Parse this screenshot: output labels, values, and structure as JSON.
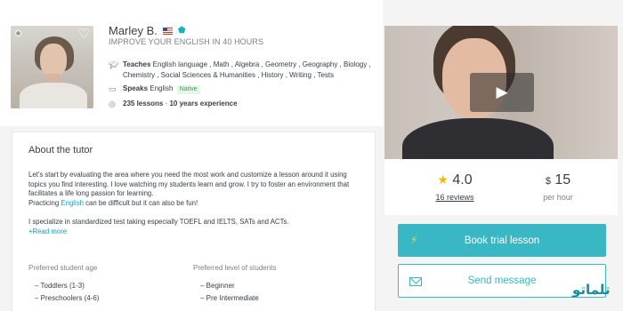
{
  "profile": {
    "name": "Marley B.",
    "flag_icon": "us-flag-icon",
    "verified_icon": "verified-check-icon",
    "headline": "IMPROVE YOUR ENGLISH IN 40 HOURS",
    "online_color": "#9aa0a6",
    "teaches_label": "Teaches",
    "teaches_value": " English language , Math , Algebra , Geometry , Geography , Biology , Chemistry , Social Sciences & Humanities , History , Writing , Tests",
    "speaks_label": "Speaks",
    "speaks_value": " English ",
    "native_badge": "Native",
    "lessons_count": "235 lessons",
    "lessons_sep": " · ",
    "experience": "10 years experience"
  },
  "about": {
    "title": "About the tutor",
    "para1": "Let's start by evaluating the area where you need the most work and customize a lesson around it using topics you find interesting. I love watching my students learn and grow. I try to foster an environment that facilitates a life long passion for learning.",
    "para2_pre": "Practicing ",
    "para2_link": "English",
    "para2_post": " can be difficult but it can also be fun!",
    "para3": "I specialize in standardized test taking especially TOEFL and IELTS, SATs and ACTs.",
    "read_more": "+Read more",
    "pref_age_label": "Preferred student age",
    "pref_level_label": "Preferred level of students",
    "ages": [
      "– Toddlers (1-3)",
      "– Preschoolers (4-6)"
    ],
    "levels": [
      "– Beginner",
      "– Pre Intermediate"
    ]
  },
  "stats": {
    "rating": "4.0",
    "reviews_count": "16",
    "reviews_word": " reviews",
    "currency": "$",
    "price": "15",
    "per_hour": "per hour"
  },
  "actions": {
    "book_label": "Book trial lesson",
    "message_label": "Send message"
  },
  "watermark": "تلماتو",
  "colors": {
    "accent": "#3ab7c4",
    "star": "#f5b800",
    "native_green": "#3ea24c"
  }
}
